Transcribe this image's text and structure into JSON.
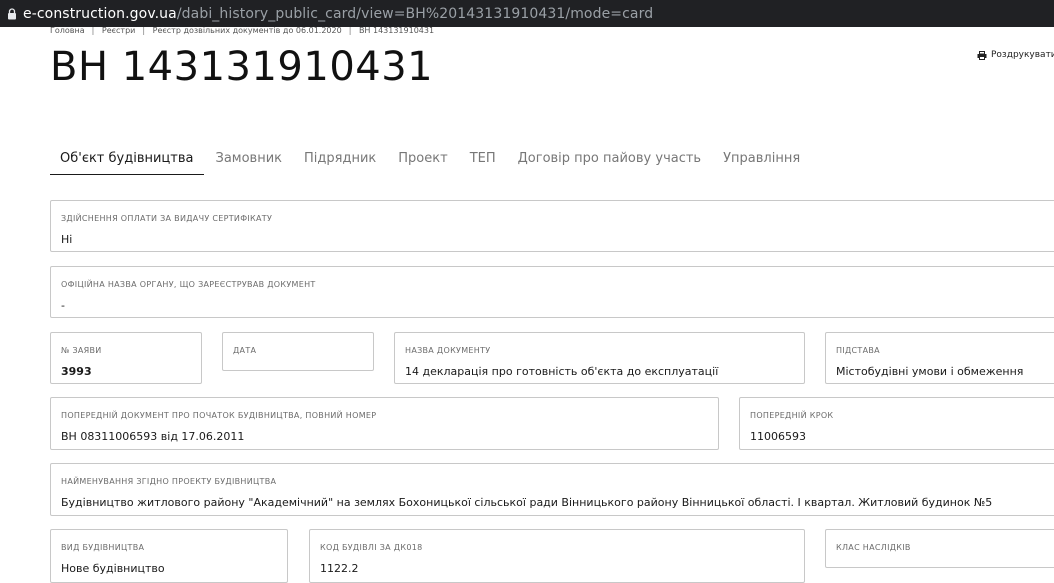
{
  "browser": {
    "url_host": "e-construction.gov.ua",
    "url_path": "/dabi_history_public_card/view=BH%20143131910431/mode=card"
  },
  "breadcrumb": [
    "Головна",
    "Реєстри",
    "Реєстр дозвільних документів до 06.01.2020",
    "ВН 143131910431"
  ],
  "page_title": "ВН 143131910431",
  "print_label": "Роздрукувати",
  "tabs": [
    "Об'єкт будівництва",
    "Замовник",
    "Підрядник",
    "Проект",
    "ТЕП",
    "Договір про пайову участь",
    "Управління"
  ],
  "fields": {
    "payment": {
      "label": "Здійснення оплати за видачу сертифікату",
      "value": "Ні"
    },
    "authority": {
      "label": "Офіційна назва органу, що зареєстрував документ",
      "value": "-"
    },
    "application_no": {
      "label": "№ заяви",
      "value": "3993"
    },
    "date": {
      "label": "Дата",
      "value": ""
    },
    "doc_name": {
      "label": "Назва документу",
      "value": "14 декларація про готовність об'єкта до експлуатації"
    },
    "basis": {
      "label": "Підстава",
      "value": "Містобудівні умови і обмеження"
    },
    "prev_doc": {
      "label": "Попередній документ про початок будівництва, повний номер",
      "value": "ВН 08311006593 від 17.06.2011"
    },
    "prev_step": {
      "label": "Попередній крок",
      "value": "11006593"
    },
    "project_name": {
      "label": "Найменування згідно проекту будівництва",
      "value": "Будівництво житлового району \"Академічний\" на землях Бохоницької сільської ради Вінницького району Вінницької області. І квартал. Житловий будинок №5"
    },
    "construction_type": {
      "label": "Вид будівництва",
      "value": "Нове будівництво"
    },
    "building_code": {
      "label": "Код будівлі за ДК018",
      "value": "1122.2"
    },
    "consequence_class": {
      "label": "Клас наслідків",
      "value": ""
    }
  },
  "icons": {
    "lock": "lock-icon",
    "print": "printer-icon"
  }
}
